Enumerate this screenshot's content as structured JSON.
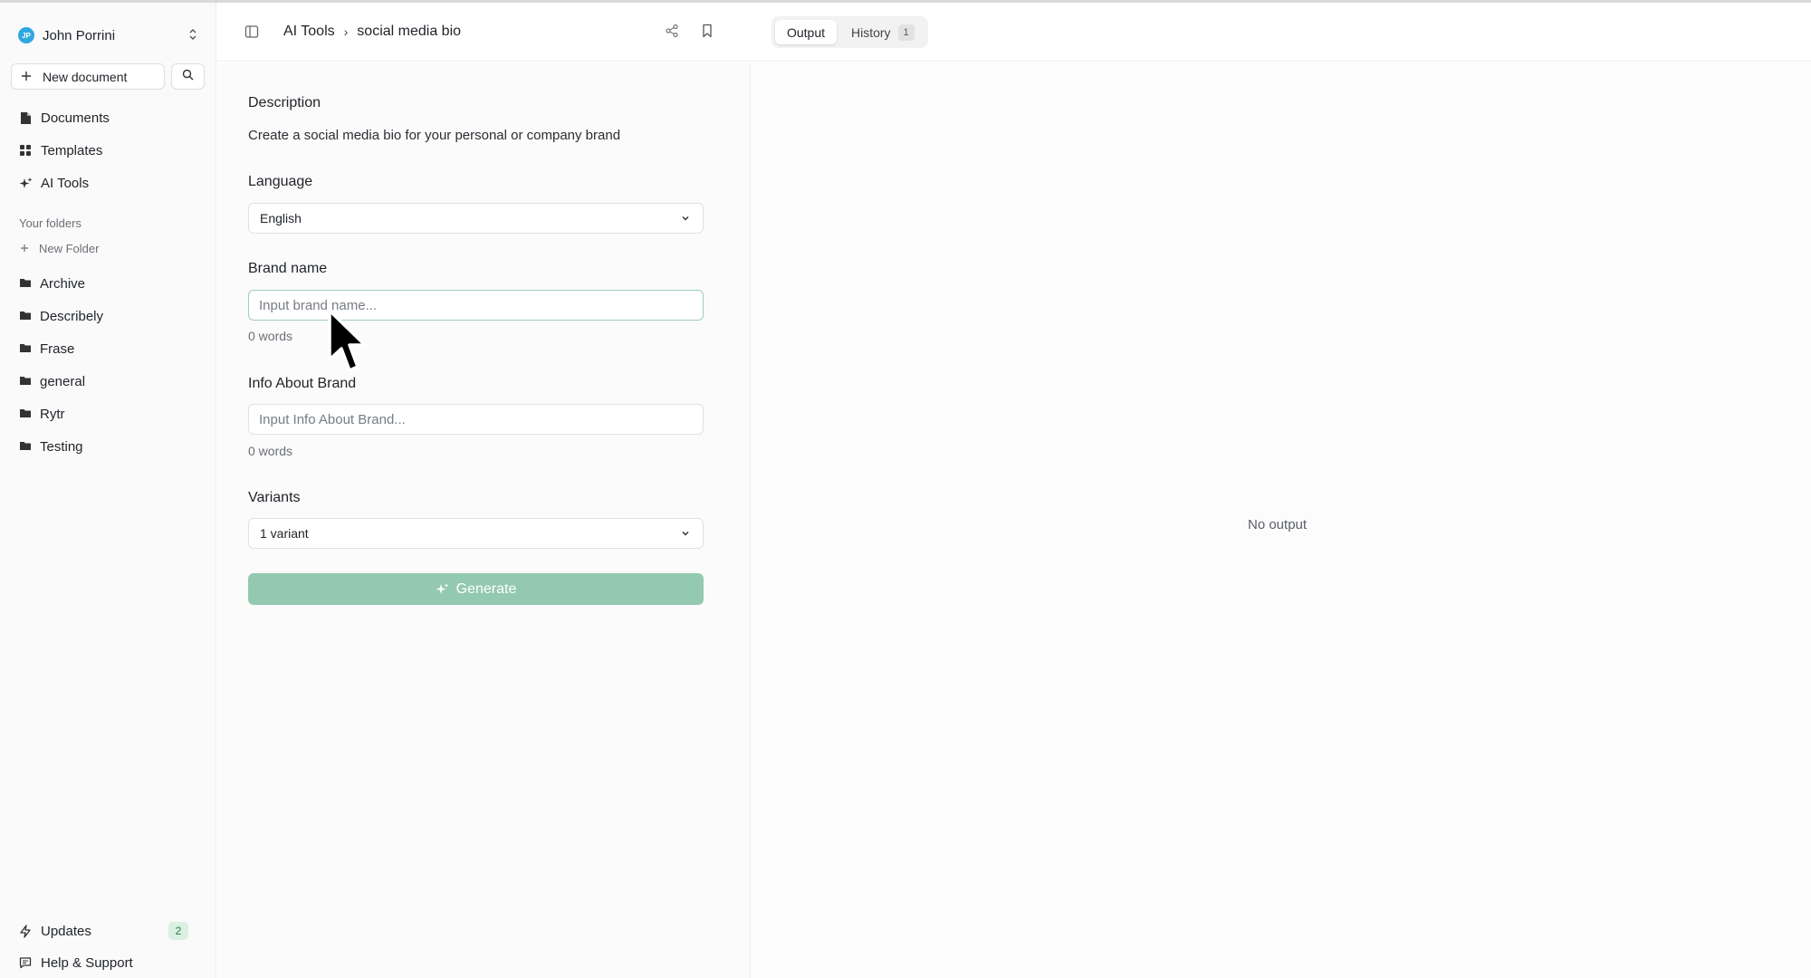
{
  "user": {
    "name": "John Porrini",
    "initials": "JP"
  },
  "sidebar": {
    "new_document_label": "New document",
    "nav": [
      {
        "label": "Documents",
        "icon": "document-icon"
      },
      {
        "label": "Templates",
        "icon": "grid-icon"
      },
      {
        "label": "AI Tools",
        "icon": "sparkle-icon"
      }
    ],
    "folders_section_label": "Your folders",
    "new_folder_label": "New Folder",
    "folders": [
      "Archive",
      "Describely",
      "Frase",
      "general",
      "Rytr",
      "Testing"
    ],
    "updates_label": "Updates",
    "updates_count": "2",
    "help_label": "Help & Support"
  },
  "header": {
    "breadcrumb_parent": "AI Tools",
    "breadcrumb_separator": "›",
    "breadcrumb_current": "social media bio"
  },
  "tabs": {
    "output_label": "Output",
    "history_label": "History",
    "history_count": "1"
  },
  "form": {
    "description_label": "Description",
    "description_text": "Create a social media bio for your personal or company brand",
    "language_label": "Language",
    "language_value": "English",
    "brand_name_label": "Brand name",
    "brand_name_placeholder": "Input brand name...",
    "brand_name_words": "0 words",
    "info_label": "Info About Brand",
    "info_placeholder": "Input Info About Brand...",
    "info_words": "0 words",
    "variants_label": "Variants",
    "variants_value": "1 variant",
    "generate_label": "Generate"
  },
  "output": {
    "empty_text": "No output"
  },
  "colors": {
    "accent_green": "#93c9b0",
    "avatar_blue": "#2ea8e0",
    "badge_green_bg": "#d9f0e3"
  }
}
